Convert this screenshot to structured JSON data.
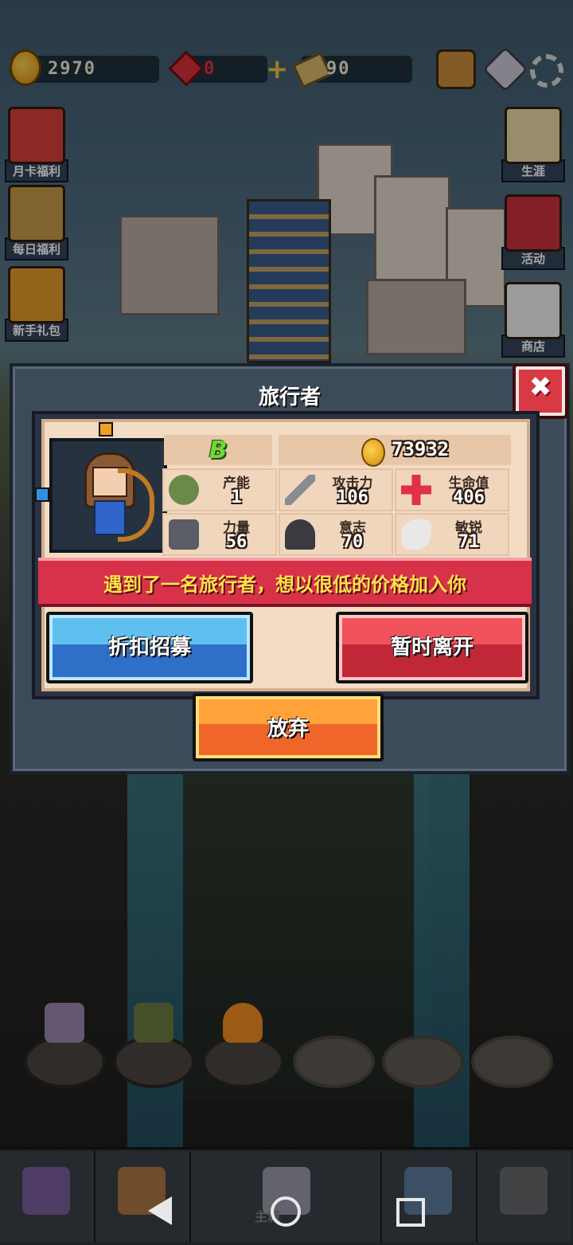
{
  "hud": {
    "gold": "2970",
    "gems": "0",
    "tickets": "90"
  },
  "left_menu": [
    {
      "label": "月卡福利"
    },
    {
      "label": "每日福利"
    },
    {
      "label": "新手礼包"
    }
  ],
  "right_menu": [
    {
      "label": "生涯"
    },
    {
      "label": "活动"
    },
    {
      "label": "商店"
    }
  ],
  "dialog": {
    "title": "旅行者",
    "close_symbol": "✖",
    "hero": {
      "rank": "B",
      "price": "73932",
      "stats": {
        "productivity": {
          "name": "产能",
          "value": "1"
        },
        "attack": {
          "name": "攻击力",
          "value": "106"
        },
        "hp": {
          "name": "生命值",
          "value": "406"
        },
        "strength": {
          "name": "力量",
          "value": "56"
        },
        "will": {
          "name": "意志",
          "value": "70"
        },
        "agility": {
          "name": "敏锐",
          "value": "71"
        }
      }
    },
    "message": "遇到了一名旅行者，想以很低的价格加入你",
    "buttons": {
      "recruit": "折扣招募",
      "leave": "暂时离开",
      "abandon": "放弃"
    }
  },
  "bottom_nav": {
    "center_label": "主城"
  },
  "colors": {
    "dialog_bg": "#3d4a5a",
    "card_bg": "#f3dcc4",
    "banner": "#d8324a",
    "banner_text": "#ffe14a",
    "btn_blue": "#2e6fc8",
    "btn_red": "#c02838",
    "btn_orange": "#f0662a",
    "rank_green": "#72d63a"
  },
  "icons": [
    "coin-icon",
    "gem-icon",
    "plus-icon",
    "ticket-icon",
    "hero-banner-icon",
    "mail-icon",
    "settings-icon",
    "close-icon",
    "worker-icon",
    "sword-icon",
    "health-cross-icon",
    "anvil-icon",
    "statue-icon",
    "wings-icon"
  ]
}
